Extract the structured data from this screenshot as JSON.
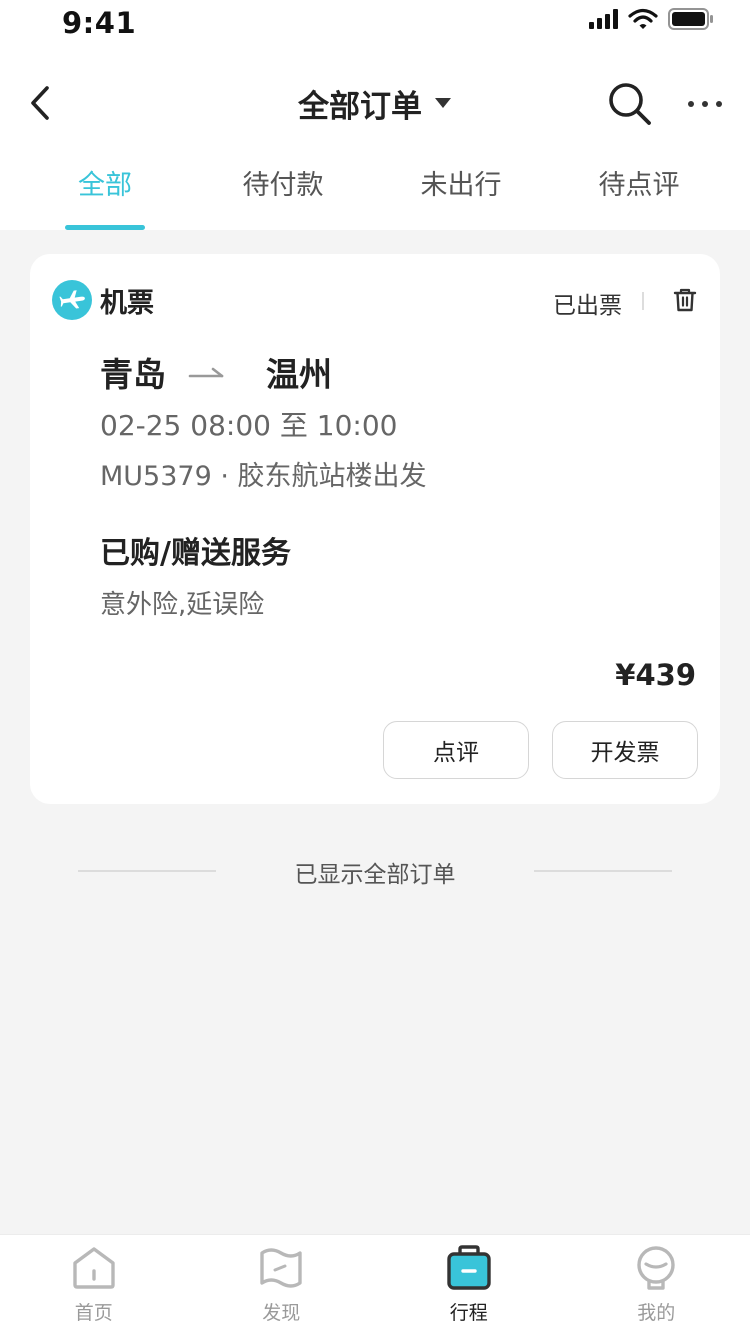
{
  "status_bar": {
    "time": "9:41"
  },
  "nav": {
    "title": "全部订单"
  },
  "tabs": [
    {
      "label": "全部",
      "active": true
    },
    {
      "label": "待付款",
      "active": false
    },
    {
      "label": "未出行",
      "active": false
    },
    {
      "label": "待点评",
      "active": false
    }
  ],
  "order": {
    "type": "机票",
    "status": "已出票",
    "from_city": "青岛",
    "to_city": "温州",
    "datetime": "02-25 08:00 至 10:00",
    "flight_info": "MU5379 · 胶东航站楼出发",
    "services_title": "已购/赠送服务",
    "services": "意外险,延误险",
    "price": "¥439",
    "buttons": {
      "review": "点评",
      "invoice": "开发票"
    }
  },
  "end_text": "已显示全部订单",
  "tabbar": [
    {
      "label": "首页",
      "icon": "home-icon",
      "active": false
    },
    {
      "label": "发现",
      "icon": "map-icon",
      "active": false
    },
    {
      "label": "行程",
      "icon": "luggage-icon",
      "active": true
    },
    {
      "label": "我的",
      "icon": "profile-icon",
      "active": false
    }
  ],
  "colors": {
    "accent": "#39c4d9",
    "background": "#f4f4f4",
    "card": "#ffffff",
    "text": "#222222",
    "muted": "#666666"
  }
}
